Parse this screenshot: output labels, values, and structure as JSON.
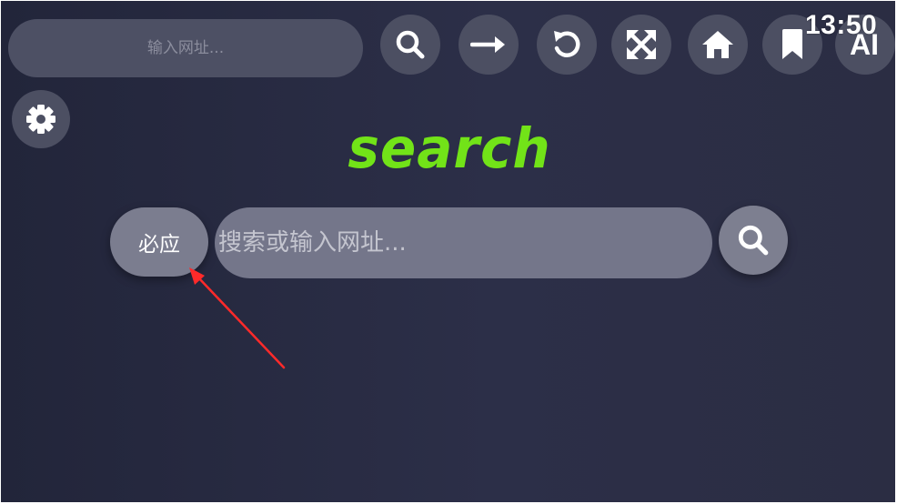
{
  "top_bar": {
    "url_placeholder": "输入网址...",
    "buttons": [
      {
        "name": "search",
        "icon": "search-icon"
      },
      {
        "name": "go",
        "icon": "arrow-right-icon"
      },
      {
        "name": "refresh",
        "icon": "refresh-icon"
      },
      {
        "name": "fullscreen",
        "icon": "expand-icon"
      },
      {
        "name": "home",
        "icon": "home-icon"
      },
      {
        "name": "bookmark",
        "icon": "bookmark-icon"
      }
    ],
    "ai_label": "AI",
    "clock": "13:50"
  },
  "settings": {
    "icon": "gear-icon"
  },
  "main": {
    "brand": "search",
    "engine_label": "必应",
    "search_placeholder": "搜索或输入网址...",
    "submit_icon": "search-icon"
  },
  "colors": {
    "brand": "#72e318",
    "annotation_arrow": "#ff2a2a",
    "background": "#2c2f48"
  }
}
